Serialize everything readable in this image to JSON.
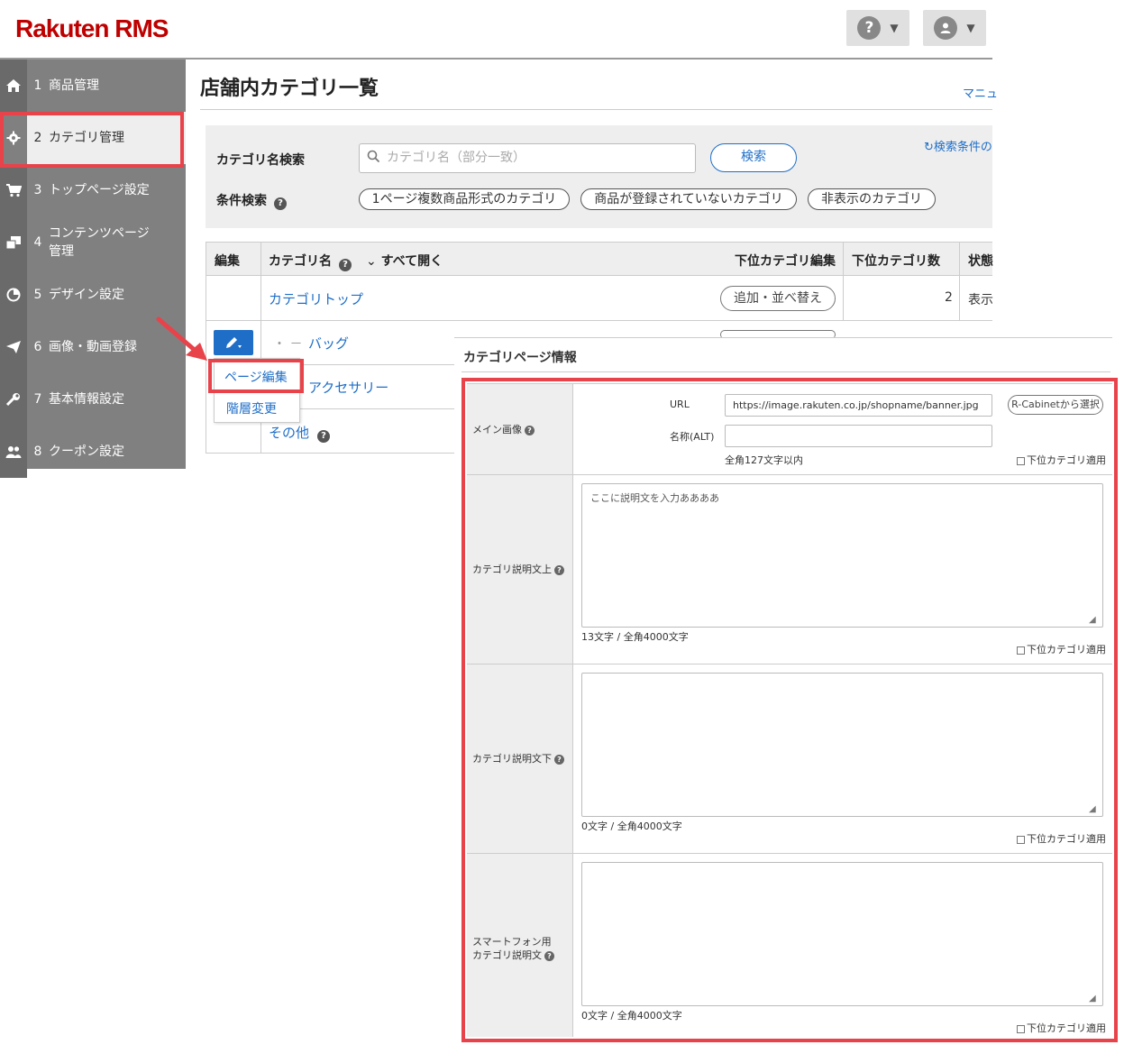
{
  "header": {
    "logo": "Rakuten RMS",
    "help_icon_glyph": "?",
    "chevron": "⌄"
  },
  "sidebar": {
    "items": [
      {
        "num": "1",
        "label": "商品管理"
      },
      {
        "num": "2",
        "label": "カテゴリ管理"
      },
      {
        "num": "3",
        "label": "トップページ設定"
      },
      {
        "num": "4",
        "label": "コンテンツページ管理"
      },
      {
        "num": "5",
        "label": "デザイン設定"
      },
      {
        "num": "6",
        "label": "画像・動画登録"
      },
      {
        "num": "7",
        "label": "基本情報設定"
      },
      {
        "num": "8",
        "label": "クーポン設定"
      }
    ]
  },
  "page": {
    "title": "店舗内カテゴリ一覧",
    "manual_link": "マニュ"
  },
  "search": {
    "name_label": "カテゴリ名検索",
    "placeholder": "カテゴリ名（部分一致）",
    "button": "検索",
    "reset_link": "検索条件の",
    "filter_label": "条件検索",
    "chips": [
      "1ページ複数商品形式のカテゴリ",
      "商品が登録されていないカテゴリ",
      "非表示のカテゴリ"
    ]
  },
  "table": {
    "headers": {
      "edit": "編集",
      "name": "カテゴリ名",
      "expand_all": "すべて開く",
      "sub_edit": "下位カテゴリ編集",
      "sub_count": "下位カテゴリ数",
      "status": "状態"
    },
    "rows": [
      {
        "name": "カテゴリトップ",
        "action": "追加・並べ替え",
        "count": "2",
        "status": "表示"
      },
      {
        "name": "バッグ",
        "prefix": "・ －"
      },
      {
        "name": "アクセサリー"
      },
      {
        "name": "その他"
      }
    ]
  },
  "dropdown": {
    "page_edit": "ページ編集",
    "hierarchy_change": "階層変更"
  },
  "overlay": {
    "title": "カテゴリページ情報",
    "main_image": {
      "label": "メイン画像",
      "url_label": "URL",
      "url_value": "https://image.rakuten.co.jp/shopname/banner.jpg",
      "cabinet_button": "R-Cabinetから選択",
      "alt_label": "名称(ALT)",
      "alt_hint": "全角127文字以内",
      "apply_sub": "下位カテゴリ適用"
    },
    "desc_upper": {
      "label": "カテゴリ説明文上",
      "value": "ここに説明文を入力ああああ",
      "counter": "13文字 / 全角4000文字",
      "apply_sub": "下位カテゴリ適用"
    },
    "desc_lower": {
      "label": "カテゴリ説明文下",
      "value": "",
      "counter": "0文字 / 全角4000文字",
      "apply_sub": "下位カテゴリ適用"
    },
    "sp_desc": {
      "label_line1": "スマートフォン用",
      "label_line2": "カテゴリ説明文",
      "value": "",
      "counter": "0文字 / 全角4000文字",
      "apply_sub": "下位カテゴリ適用"
    }
  },
  "colors": {
    "brand": "#bf0000",
    "link": "#1e6ec8",
    "highlight": "#e8424a",
    "sidebar": "#808080"
  }
}
